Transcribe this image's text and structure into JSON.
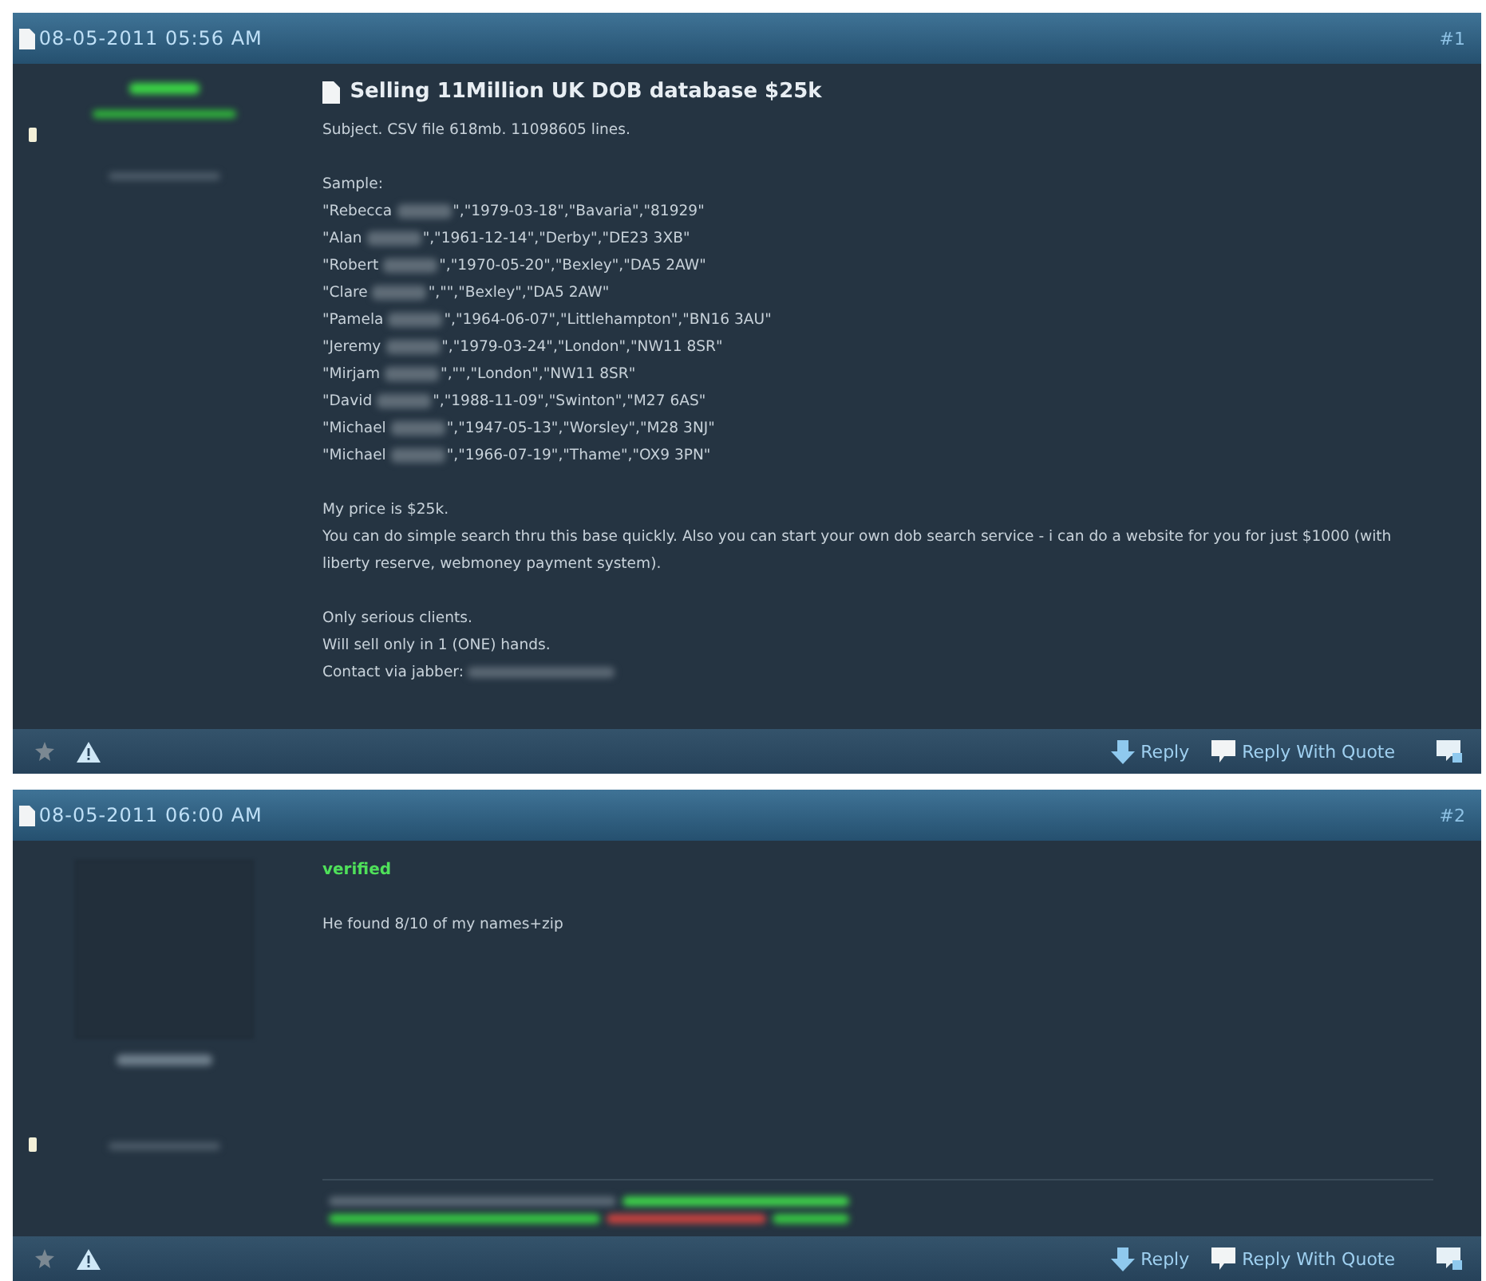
{
  "posts": [
    {
      "date": "08-05-2011 05:56 AM",
      "number": "#1",
      "title": "Selling 11Million UK DOB database $25k",
      "has_avatar": false,
      "has_signature": false,
      "body": [
        {
          "kind": "text",
          "text": "Subject. CSV file 618mb. 11098605 lines."
        },
        {
          "kind": "blank"
        },
        {
          "kind": "text",
          "text": "Sample:"
        },
        {
          "kind": "sample",
          "name": "\"Rebecca",
          "rest": "\",\"1979-03-18\",\"Bavaria\",\"81929\""
        },
        {
          "kind": "sample",
          "name": "\"Alan",
          "rest": "\",\"1961-12-14\",\"Derby\",\"DE23 3XB\""
        },
        {
          "kind": "sample",
          "name": "\"Robert",
          "rest": "\",\"1970-05-20\",\"Bexley\",\"DA5 2AW\""
        },
        {
          "kind": "sample",
          "name": "\"Clare",
          "rest": "\",\"\",\"Bexley\",\"DA5 2AW\""
        },
        {
          "kind": "sample",
          "name": "\"Pamela",
          "rest": "\",\"1964-06-07\",\"Littlehampton\",\"BN16 3AU\""
        },
        {
          "kind": "sample",
          "name": "\"Jeremy",
          "rest": "\",\"1979-03-24\",\"London\",\"NW11 8SR\""
        },
        {
          "kind": "sample",
          "name": "\"Mirjam",
          "rest": "\",\"\",\"London\",\"NW11 8SR\""
        },
        {
          "kind": "sample",
          "name": "\"David",
          "rest": "\",\"1988-11-09\",\"Swinton\",\"M27 6AS\""
        },
        {
          "kind": "sample",
          "name": "\"Michael",
          "rest": "\",\"1947-05-13\",\"Worsley\",\"M28 3NJ\""
        },
        {
          "kind": "sample",
          "name": "\"Michael",
          "rest": "\",\"1966-07-19\",\"Thame\",\"OX9 3PN\""
        },
        {
          "kind": "blank"
        },
        {
          "kind": "text",
          "text": "My price is $25k."
        },
        {
          "kind": "text",
          "text": "You can do simple search thru this base quickly. Also you can start your own dob search service - i can do a website for you for just $1000 (with liberty reserve, webmoney payment system)."
        },
        {
          "kind": "blank"
        },
        {
          "kind": "text",
          "text": "Only serious clients."
        },
        {
          "kind": "text",
          "text": "Will sell only in 1 (ONE) hands."
        },
        {
          "kind": "contact",
          "text": "Contact via jabber:"
        }
      ],
      "actions": [
        "Reply",
        "Reply With Quote"
      ]
    },
    {
      "date": "08-05-2011 06:00 AM",
      "number": "#2",
      "has_avatar": true,
      "has_signature": true,
      "body": [
        {
          "kind": "highlight",
          "text": "verified"
        },
        {
          "kind": "blank"
        },
        {
          "kind": "text",
          "text": "He found 8/10 of my names+zip"
        }
      ],
      "actions": [
        "Reply",
        "Reply With Quote"
      ]
    }
  ]
}
